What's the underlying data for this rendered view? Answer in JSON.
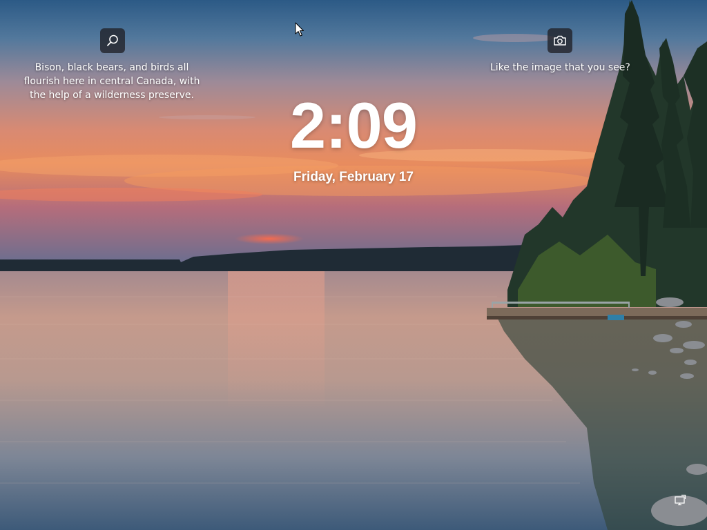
{
  "spotlight": {
    "fact_text": "Bison, black bears, and birds all flourish here in central Canada, with the help of a wilderness preserve.",
    "like_text": "Like the image that you see?",
    "search_icon": "search-icon",
    "camera_icon": "camera-icon"
  },
  "clock": {
    "time": "2:09",
    "date": "Friday, February 17"
  },
  "status": {
    "network_icon": "network-icon"
  },
  "colors": {
    "sky_top": "#2f5d86",
    "sunset_orange": "#e8845a",
    "water": "#8f8388",
    "text": "#ffffff"
  }
}
